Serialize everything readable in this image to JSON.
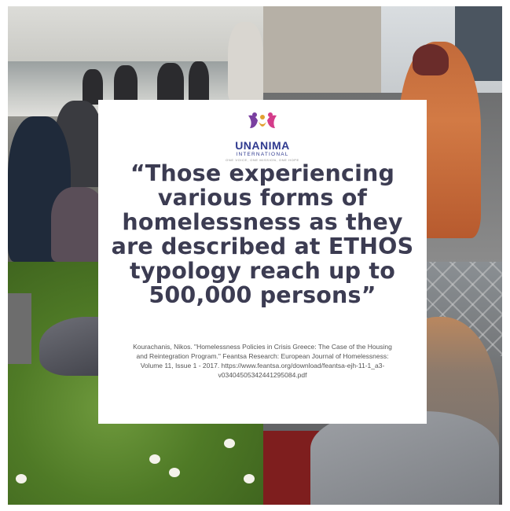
{
  "logo": {
    "name": "UNANIMA",
    "subtitle": "INTERNATIONAL",
    "tagline": "ONE VOICE, ONE MISSION, ONE HOPE",
    "colors": {
      "left": "#7a3fa0",
      "right": "#d43c8a",
      "center": "#e2a030",
      "text": "#2f3a8f"
    }
  },
  "quote": "“Those experiencing various forms of homelessness as they are described at ETHOS typology reach up to 500,000 persons”",
  "citation": "Kourachanis, Nikos. \"Homelessness Policies in Crisis Greece: The Case of the Housing and Reintegration Program.\" Feantsa Research: European Journal of Homelessness: Volume 11, Issue 1 - 2017. https://www.feantsa.org/download/feantsa-ejh-11-1_a3-v03404505342441295084.pdf",
  "colors": {
    "quote_text": "#3c3c52",
    "card_bg": "#ffffff"
  }
}
